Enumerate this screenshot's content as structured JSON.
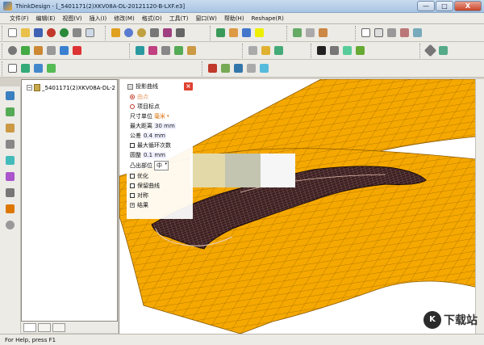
{
  "window": {
    "title": "ThinkDesign - [_5401171(2)XKV08A-DL-20121120-B-LXF.e3]",
    "controls": {
      "minimize": "—",
      "maximize": "□",
      "close": "X"
    }
  },
  "menu": [
    "文件(F)",
    "编辑(E)",
    "视图(V)",
    "插入(I)",
    "修改(M)",
    "格式(O)",
    "工具(T)",
    "窗口(W)",
    "帮助(H)",
    "Reshape(R)"
  ],
  "tree": {
    "root_label": "_5401171(2)XKV08A-DL-2"
  },
  "panel": {
    "title": "投影曲线",
    "radio_1": "曲点",
    "radio_2": "项目标点",
    "units_label": "尺寸单位",
    "units_value": "毫米",
    "max_dist_label": "最大距离",
    "max_dist_value": "30 mm",
    "tolerance_label": "公差",
    "tolerance_value": "0.4 mm",
    "max_iter_label": "最大循环次数",
    "radius_label": "圆整",
    "radius_value": "0.1 mm",
    "bulge_label": "凸出部位",
    "bulge_value": "中",
    "opt_1": "优化",
    "opt_2": "保留曲线",
    "opt_3": "对称",
    "result_label": "结果"
  },
  "status": "For Help, press F1",
  "watermark": {
    "logo": "K",
    "text": "下载站"
  },
  "colors": {
    "surface": "#f5a800",
    "mesh": "#9a6a00",
    "part": "#3a1f20",
    "close": "#e04030"
  }
}
